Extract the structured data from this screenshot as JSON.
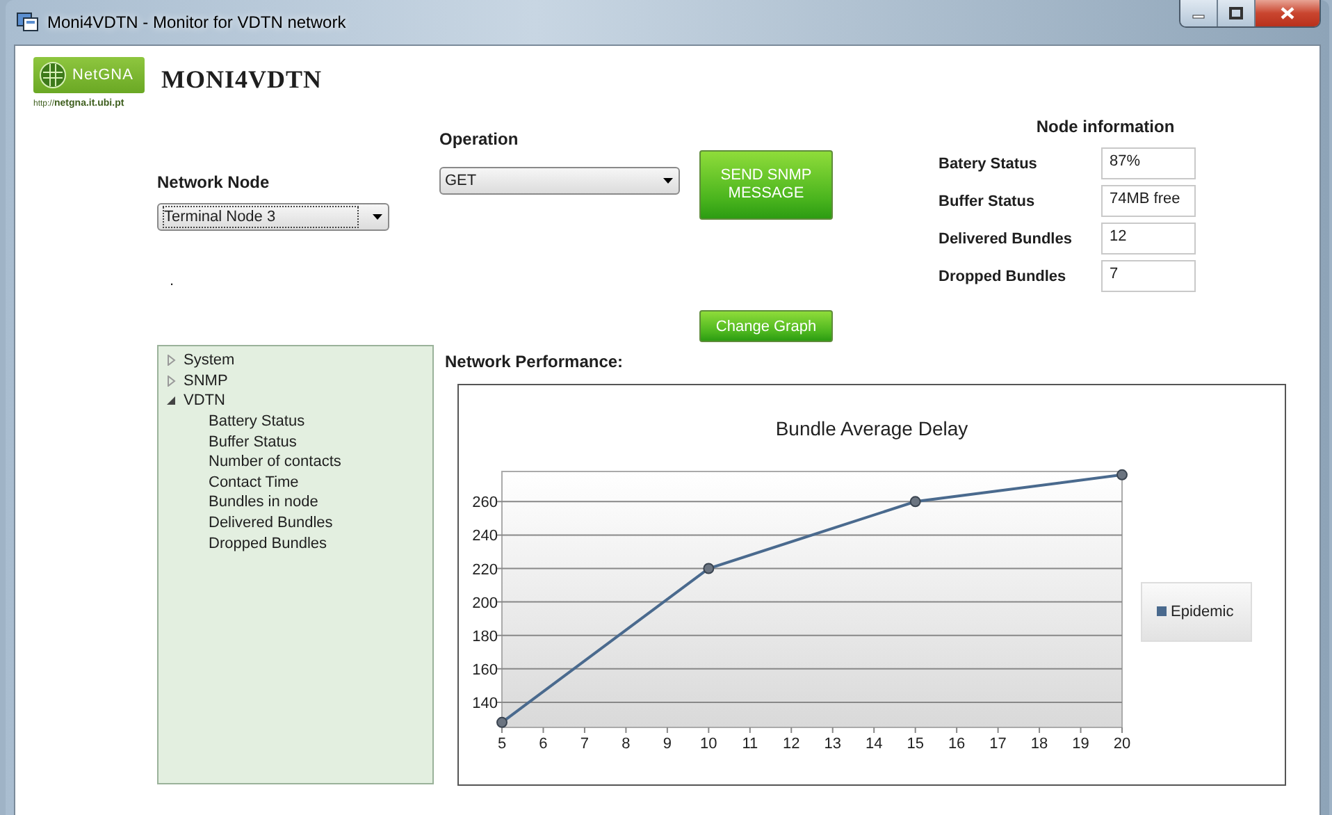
{
  "window": {
    "title": "Moni4VDTN - Monitor for VDTN network"
  },
  "logo": {
    "name": "NetGNA",
    "url": "http://**netgna.it.ubi.pt**"
  },
  "app_title": "MONI4VDTN",
  "network_node": {
    "label": "Network Node",
    "value": "Terminal Node 3"
  },
  "status_text": ".",
  "operation": {
    "label": "Operation",
    "value": "GET"
  },
  "buttons": [
    {
      "label": "SEND SNMP MESSAGE"
    },
    {
      "label": "Change Graph"
    }
  ],
  "node_information": {
    "title": "Node information",
    "fields": [
      {
        "label": "Batery Status",
        "value": "87%"
      },
      {
        "label": "Buffer Status",
        "value": "74MB free"
      },
      {
        "label": "Delivered Bundles",
        "value": "12"
      },
      {
        "label": "Dropped Bundles",
        "value": "7"
      }
    ]
  },
  "tree": [
    {
      "label": "System",
      "expanded": false
    },
    {
      "label": "SNMP",
      "expanded": false
    },
    {
      "label": "VDTN",
      "expanded": true,
      "children": [
        {
          "label": "Battery Status"
        },
        {
          "label": "Buffer Status"
        },
        {
          "label": "Number of contacts"
        },
        {
          "label": "Contact Time"
        },
        {
          "label": "Bundles in node"
        },
        {
          "label": "Delivered Bundles"
        },
        {
          "label": "Dropped Bundles"
        }
      ]
    }
  ],
  "performance": {
    "label": "Network Performance:",
    "chart_data": {
      "type": "line",
      "title": "Bundle Average Delay",
      "x": [
        5,
        10,
        15,
        20
      ],
      "series": [
        {
          "name": "Epidemic",
          "color": "#4a6a8e",
          "marker": true,
          "values": [
            128,
            220,
            260,
            276
          ]
        }
      ],
      "grid": true,
      "xlim": [
        5,
        20
      ],
      "ylim": [
        125,
        278
      ],
      "xticks": [
        5,
        6,
        7,
        8,
        9,
        10,
        11,
        12,
        13,
        14,
        15,
        16,
        17,
        18,
        19,
        20
      ],
      "yticks": [
        140,
        160,
        180,
        200,
        220,
        240,
        260
      ]
    }
  }
}
